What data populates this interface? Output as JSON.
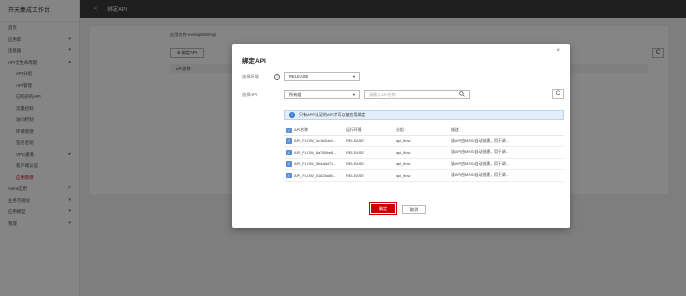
{
  "sidebar": {
    "title": "开天集成工作台",
    "items": [
      {
        "label": "首页",
        "chev": ""
      },
      {
        "label": "应用库",
        "chev": "▾"
      },
      {
        "label": "连接器",
        "chev": "▾"
      },
      {
        "label": "API全生命周期",
        "chev": "▴"
      },
      {
        "label": "API分组",
        "chev": "",
        "sub": true
      },
      {
        "label": "API管理",
        "chev": "",
        "sub": true
      },
      {
        "label": "已购买的API",
        "chev": "",
        "sub": true
      },
      {
        "label": "流量控制",
        "chev": "",
        "sub": true
      },
      {
        "label": "访问控制",
        "chev": "",
        "sub": true
      },
      {
        "label": "环境管理",
        "chev": "",
        "sub": true
      },
      {
        "label": "签名密钥",
        "chev": "",
        "sub": true
      },
      {
        "label": "VPC通道",
        "chev": "▸",
        "sub": true
      },
      {
        "label": "客户端认证",
        "chev": "",
        "sub": true
      },
      {
        "label": "应用管理",
        "chev": "",
        "sub": true,
        "active": true
      },
      {
        "label": "Astro应用",
        "chev": "↗"
      },
      {
        "label": "业务可视化",
        "chev": "▾"
      },
      {
        "label": "应用模型",
        "chev": "▾"
      },
      {
        "label": "管理",
        "chev": "▾"
      }
    ]
  },
  "topbar": {
    "back": "<",
    "title": "绑定API"
  },
  "background": {
    "info": "应用名称  evekapiDMApp",
    "bind_button": "⊕ 绑定API",
    "table_header": "API名称",
    "refresh": "C"
  },
  "modal": {
    "title": "绑定API",
    "close": "×",
    "env_label": "选择环境",
    "env_help": "?",
    "env_value": "RELEASE",
    "api_label": "选择API",
    "group_value": "所有组",
    "search_placeholder": "请输入API名称",
    "search_icon": "search-icon",
    "refresh": "C",
    "tip_icon": "!",
    "tip": "只有APP认证的API才可以被应用绑定",
    "columns": [
      "API名称",
      "运行环境",
      "分组",
      "描述"
    ],
    "rows": [
      {
        "name": "API_FLOW_4c1b5dc4...",
        "env": "RELEASE",
        "group": "api_flow",
        "desc": "该API由MSSI自动创建，用于调..."
      },
      {
        "name": "API_FLOW_6a785be8...",
        "env": "RELEASE",
        "group": "api_flow",
        "desc": "该API由MSSI自动创建，用于调..."
      },
      {
        "name": "API_FLOW_5b4a8d71...",
        "env": "RELEASE",
        "group": "api_flow",
        "desc": "该API由MSSI自动创建，用于调..."
      },
      {
        "name": "API_FLOW_51825a60...",
        "env": "RELEASE",
        "group": "api_flow",
        "desc": "该API由MSSI自动创建，用于调..."
      }
    ],
    "ok": "确定",
    "cancel": "取消"
  },
  "colors": {
    "accent": "#c7000b",
    "checkbox": "#5b8fd6",
    "topbar": "#3a3a3a"
  }
}
